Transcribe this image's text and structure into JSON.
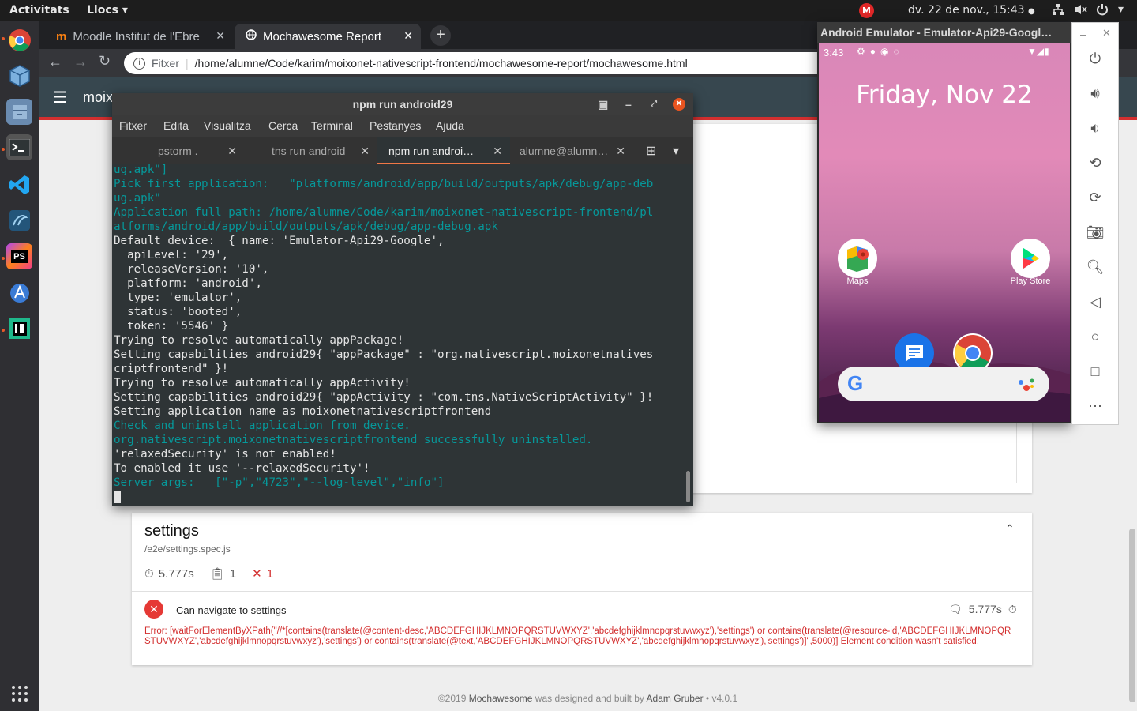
{
  "topbar": {
    "activities": "Activitats",
    "places": "Llocs",
    "clock": "dv. 22 de nov., 15:43",
    "mail_badge": "M"
  },
  "dock": {
    "items": [
      "chrome-icon",
      "virtualbox-icon",
      "files-icon",
      "terminal-icon",
      "vscode-icon",
      "mysql-workbench-icon",
      "phpstorm-icon",
      "android-studio-icon",
      "intellij-icon",
      "app-grid-icon"
    ],
    "phpstorm_label": "PS"
  },
  "chrome": {
    "tabs": [
      {
        "label": "Moodle Institut de l'Ebre",
        "favicon": "m"
      },
      {
        "label": "Mochawesome Report"
      }
    ],
    "address": {
      "prefix": "Fitxer",
      "url": "/home/alumne/Code/karim/moixonet-nativescript-frontend/mochawesome-report/mochawesome.html"
    }
  },
  "report": {
    "app_title": "moix",
    "suite": {
      "title": "settings",
      "file": "/e2e/settings.spec.js",
      "duration": "5.777s",
      "tests": "1",
      "failures": "1"
    },
    "test": {
      "title": "Can navigate to settings",
      "duration": "5.777s",
      "error": "Error: [waitForElementByXPath(\"//*[contains(translate(@content-desc,'ABCDEFGHIJKLMNOPQRSTUVWXYZ','abcdefghijklmnopqrstuvwxyz'),'settings') or contains(translate(@resource-id,'ABCDEFGHIJKLMNOPQRSTUVWXYZ','abcdefghijklmnopqrstuvwxyz'),'settings') or contains(translate(@text,'ABCDEFGHIJKLMNOPQRSTUVWXYZ','abcdefghijklmnopqrstuvwxyz'),'settings')]\",5000)] Element condition wasn't satisfied!"
    },
    "footer": {
      "copyright": "©2019",
      "brand": "Mochawesome",
      "built": "was designed and built by",
      "author": "Adam Gruber",
      "version": "• v4.0.1"
    }
  },
  "terminal": {
    "title": "npm run android29",
    "menu": [
      "Fitxer",
      "Edita",
      "Visualitza",
      "Cerca",
      "Terminal",
      "Pestanyes",
      "Ajuda"
    ],
    "tabs": [
      "pstorm .",
      "tns run android",
      "npm run androi…",
      "alumne@alumn…"
    ],
    "lines": [
      {
        "text": "ug.apk\"]",
        "color": "cyan"
      },
      {
        "text": "Pick first application:   \"platforms/android/app/build/outputs/apk/debug/app-deb",
        "color": "cyan"
      },
      {
        "text": "ug.apk\"",
        "color": "cyan"
      },
      {
        "text": "Application full path: /home/alumne/Code/karim/moixonet-nativescript-frontend/pl",
        "color": "cyan"
      },
      {
        "text": "atforms/android/app/build/outputs/apk/debug/app-debug.apk",
        "color": "cyan"
      },
      {
        "text": "Default device:  { name: 'Emulator-Api29-Google',",
        "color": "white"
      },
      {
        "text": "  apiLevel: '29',",
        "color": "white"
      },
      {
        "text": "  releaseVersion: '10',",
        "color": "white"
      },
      {
        "text": "  platform: 'android',",
        "color": "white"
      },
      {
        "text": "  type: 'emulator',",
        "color": "white"
      },
      {
        "text": "  status: 'booted',",
        "color": "white"
      },
      {
        "text": "  token: '5546' }",
        "color": "white"
      },
      {
        "text": "Trying to resolve automatically appPackage!",
        "color": "white"
      },
      {
        "text": "Setting capabilities android29{ \"appPackage\" : \"org.nativescript.moixonetnatives",
        "color": "white"
      },
      {
        "text": "criptfrontend\" }!",
        "color": "white"
      },
      {
        "text": "Trying to resolve automatically appActivity!",
        "color": "white"
      },
      {
        "text": "Setting capabilities android29{ \"appActivity : \"com.tns.NativeScriptActivity\" }!",
        "color": "white"
      },
      {
        "text": "Setting application name as moixonetnativescriptfrontend",
        "color": "white"
      },
      {
        "text": "Check and uninstall application from device.",
        "color": "cyan"
      },
      {
        "text": "org.nativescript.moixonetnativescriptfrontend successfully uninstalled.",
        "color": "cyan"
      },
      {
        "text": "'relaxedSecurity' is not enabled!",
        "color": "white"
      },
      {
        "text": "To enabled it use '--relaxedSecurity'!",
        "color": "white"
      },
      {
        "text": "Server args:   [\"-p\",\"4723\",\"--log-level\",\"info\"]",
        "color": "cyan"
      }
    ],
    "colors": {
      "cyan": "#06989a",
      "green": "#4e9a06",
      "white": "#e4e4e4"
    }
  },
  "emulator": {
    "title": "Android Emulator - Emulator-Api29-Googl…",
    "time": "3:43",
    "date": "Friday, Nov 22",
    "apps": [
      {
        "label": "Maps",
        "icon": "maps-icon"
      },
      {
        "label": "Play Store",
        "icon": "play-store-icon"
      }
    ],
    "dock_apps": [
      "messages-icon",
      "chrome-icon"
    ],
    "search_logo": "G",
    "side_buttons": [
      "power-icon",
      "volume-up-icon",
      "volume-down-icon",
      "rotate-left-icon",
      "rotate-right-icon",
      "camera-icon",
      "zoom-icon",
      "back-icon",
      "home-icon",
      "overview-icon",
      "more-icon"
    ]
  }
}
